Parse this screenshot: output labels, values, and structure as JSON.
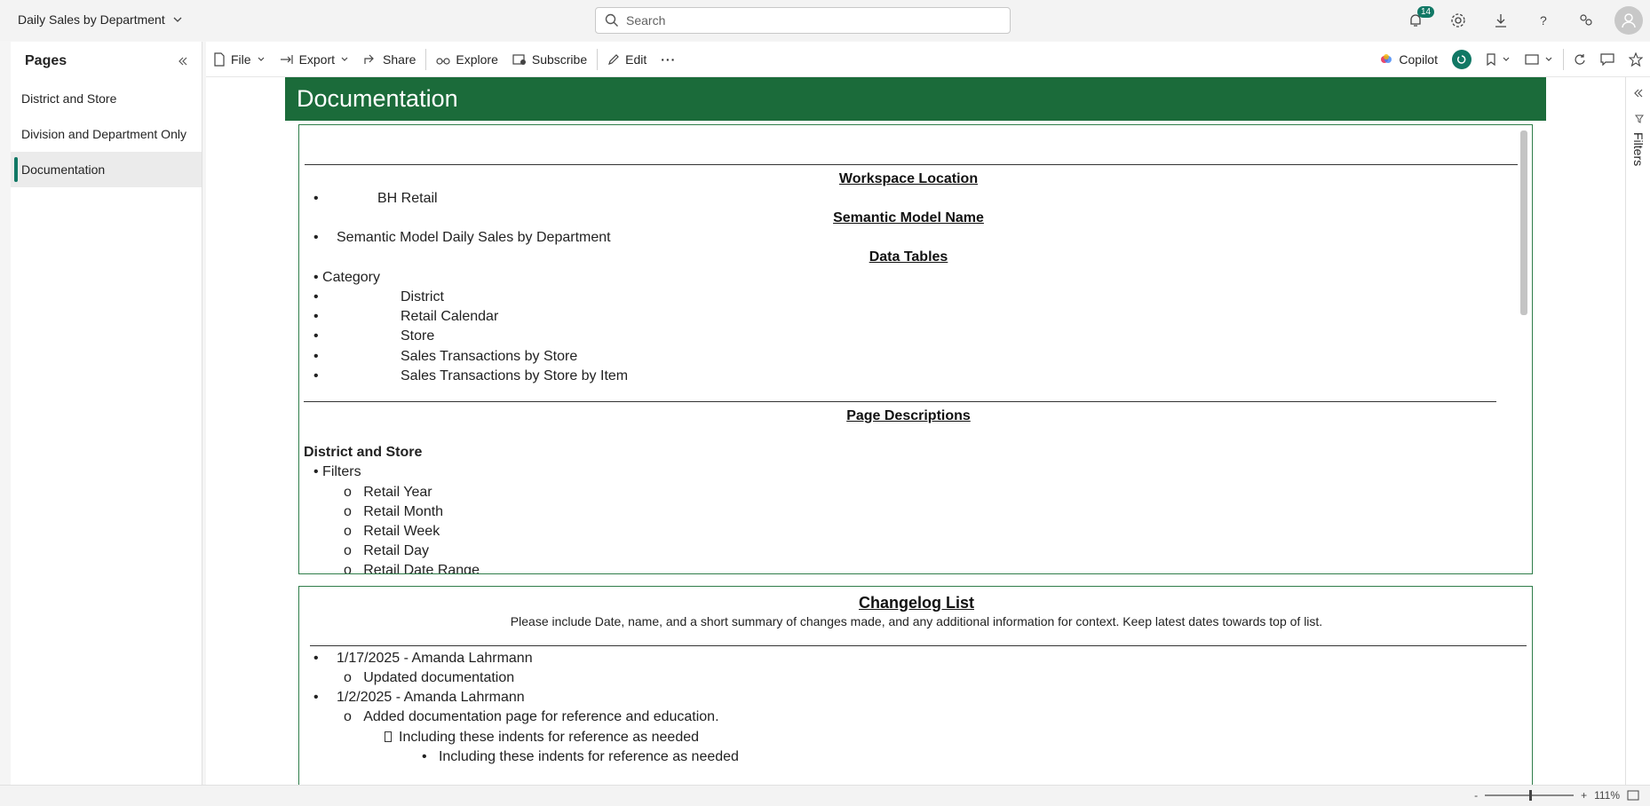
{
  "header": {
    "report_title": "Daily Sales by Department",
    "search_placeholder": "Search",
    "notification_count": "14"
  },
  "pages_pane": {
    "title": "Pages",
    "items": [
      {
        "label": "District and Store"
      },
      {
        "label": "Division and Department Only"
      },
      {
        "label": "Documentation"
      }
    ],
    "active_index": 2
  },
  "toolbar": {
    "file": "File",
    "export": "Export",
    "share": "Share",
    "explore": "Explore",
    "subscribe": "Subscribe",
    "edit": "Edit",
    "more": "···",
    "copilot": "Copilot"
  },
  "report": {
    "banner_title": "Documentation",
    "doc": {
      "workspace_heading": "Workspace Location",
      "workspace_value": "BH Retail",
      "semantic_heading": "Semantic Model Name",
      "semantic_value": "Semantic Model Daily Sales by Department",
      "tables_heading": "Data Tables",
      "tables_category": "Category",
      "tables": [
        "District",
        "Retail Calendar",
        "Store",
        "Sales Transactions by Store",
        "Sales Transactions by Store by Item"
      ],
      "page_desc_heading": "Page Descriptions",
      "page1_name": "District and Store",
      "filters_label": "Filters",
      "filters": [
        "Retail Year",
        "Retail Month",
        "Retail Week",
        "Retail Day",
        "Retail Date Range"
      ]
    },
    "changelog": {
      "title": "Changelog List",
      "instructions": "Please include Date, name, and a short summary of changes made, and any additional information for context. Keep latest dates towards top of list.",
      "entry1": "1/17/2025 - Amanda Lahrmann",
      "entry1_sub": "Updated documentation",
      "entry2": "1/2/2025 - Amanda Lahrmann",
      "entry2_sub": "Added documentation page for reference and education.",
      "entry2_sub2": "Including these indents for reference as needed",
      "entry2_sub3": "Including these indents for reference as needed"
    }
  },
  "filters_pane": {
    "label": "Filters"
  },
  "status": {
    "zoom_minus": "-",
    "zoom_plus": "+",
    "zoom_level": "111%"
  },
  "colors": {
    "banner": "#1b6b3a",
    "accent": "#117865",
    "box_border": "#2f7d4a"
  }
}
